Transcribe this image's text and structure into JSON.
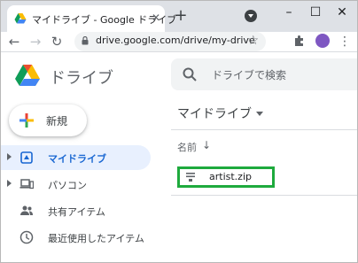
{
  "browser": {
    "tab_title": "マイドライブ - Google ドライブ",
    "tab_close_icon": "close-icon",
    "new_tab_icon": "plus-icon",
    "window_controls": {
      "minimize": "–",
      "maximize": "☐",
      "close": "✕"
    },
    "url": "drive.google.com/drive/my-drive",
    "avatar_color": "#7e57c2"
  },
  "app": {
    "title": "ドライブ",
    "search_placeholder": "ドライブで検索"
  },
  "sidebar": {
    "new_label": "新規",
    "items": [
      {
        "label": "マイドライブ",
        "active": true,
        "icon": "my-drive-icon"
      },
      {
        "label": "パソコン",
        "active": false,
        "icon": "computer-icon"
      },
      {
        "label": "共有アイテム",
        "active": false,
        "icon": "people-icon"
      },
      {
        "label": "最近使用したアイテム",
        "active": false,
        "icon": "clock-icon"
      }
    ]
  },
  "main": {
    "title": "マイドライブ",
    "column_name": "名前",
    "files": [
      {
        "name": "artist.zip",
        "highlighted": true
      }
    ]
  },
  "colors": {
    "accent": "#1967d2",
    "active_bg": "#e8f0fe",
    "highlight": "#1eaa3d"
  }
}
